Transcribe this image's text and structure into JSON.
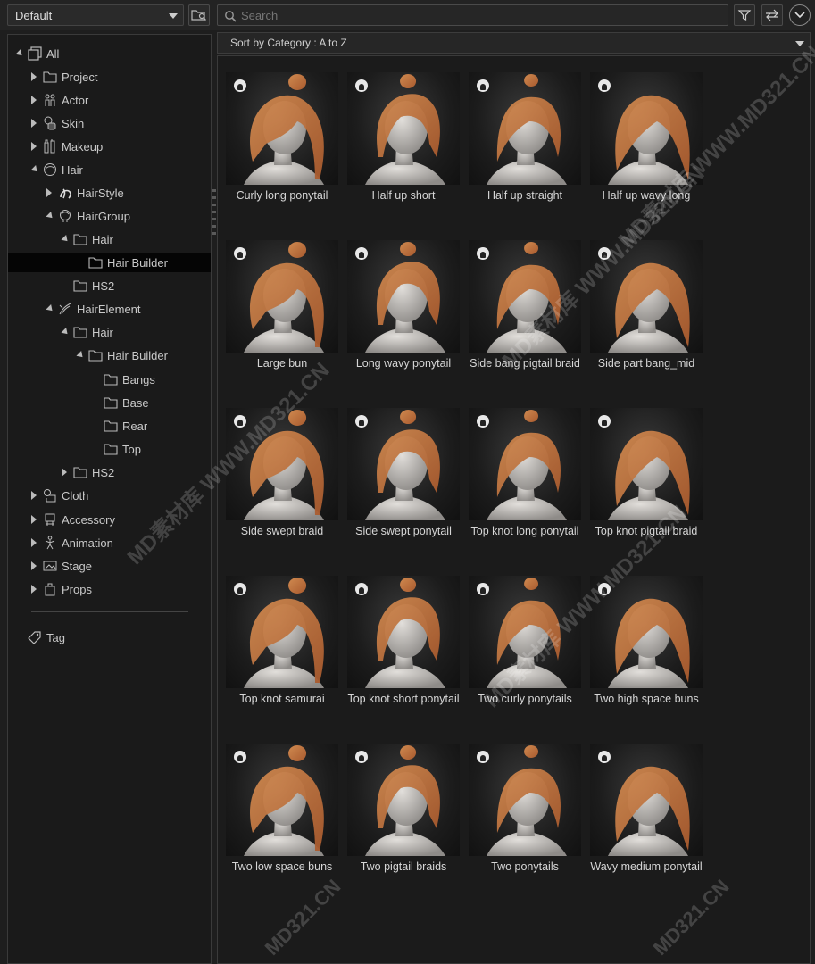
{
  "toolbar": {
    "preset_value": "Default",
    "search_placeholder": "Search"
  },
  "sortbar": {
    "label": "Sort by Category : A to Z"
  },
  "tree": [
    {
      "label": "All",
      "icon": "all-icon",
      "arrow": "down",
      "indent": 0,
      "selected": false
    },
    {
      "label": "Project",
      "icon": "folder-icon",
      "arrow": "right",
      "indent": 1,
      "selected": false
    },
    {
      "label": "Actor",
      "icon": "actor-icon",
      "arrow": "right",
      "indent": 1,
      "selected": false
    },
    {
      "label": "Skin",
      "icon": "skin-icon",
      "arrow": "right",
      "indent": 1,
      "selected": false
    },
    {
      "label": "Makeup",
      "icon": "makeup-icon",
      "arrow": "right",
      "indent": 1,
      "selected": false
    },
    {
      "label": "Hair",
      "icon": "hair-icon",
      "arrow": "down",
      "indent": 1,
      "selected": false
    },
    {
      "label": "HairStyle",
      "icon": "hairstyle-icon",
      "arrow": "right",
      "indent": 2,
      "selected": false
    },
    {
      "label": "HairGroup",
      "icon": "hairgroup-icon",
      "arrow": "down",
      "indent": 2,
      "selected": false
    },
    {
      "label": "Hair",
      "icon": "folder-icon",
      "arrow": "down",
      "indent": 3,
      "selected": false
    },
    {
      "label": "Hair Builder",
      "icon": "folder-icon",
      "arrow": "none",
      "indent": 4,
      "selected": true
    },
    {
      "label": "HS2",
      "icon": "folder-icon",
      "arrow": "none",
      "indent": 3,
      "selected": false
    },
    {
      "label": "HairElement",
      "icon": "hairelement-icon",
      "arrow": "down",
      "indent": 2,
      "selected": false
    },
    {
      "label": "Hair",
      "icon": "folder-icon",
      "arrow": "down",
      "indent": 3,
      "selected": false
    },
    {
      "label": "Hair Builder",
      "icon": "folder-icon",
      "arrow": "down",
      "indent": 4,
      "selected": false
    },
    {
      "label": "Bangs",
      "icon": "folder-icon",
      "arrow": "none",
      "indent": 5,
      "selected": false
    },
    {
      "label": "Base",
      "icon": "folder-icon",
      "arrow": "none",
      "indent": 5,
      "selected": false
    },
    {
      "label": "Rear",
      "icon": "folder-icon",
      "arrow": "none",
      "indent": 5,
      "selected": false
    },
    {
      "label": "Top",
      "icon": "folder-icon",
      "arrow": "none",
      "indent": 5,
      "selected": false
    },
    {
      "label": "HS2",
      "icon": "folder-icon",
      "arrow": "right",
      "indent": 3,
      "selected": false
    },
    {
      "label": "Cloth",
      "icon": "cloth-icon",
      "arrow": "right",
      "indent": 1,
      "selected": false
    },
    {
      "label": "Accessory",
      "icon": "accessory-icon",
      "arrow": "right",
      "indent": 1,
      "selected": false
    },
    {
      "label": "Animation",
      "icon": "animation-icon",
      "arrow": "right",
      "indent": 1,
      "selected": false
    },
    {
      "label": "Stage",
      "icon": "stage-icon",
      "arrow": "right",
      "indent": 1,
      "selected": false
    },
    {
      "label": "Props",
      "icon": "props-icon",
      "arrow": "right",
      "indent": 1,
      "selected": false
    }
  ],
  "tag": {
    "label": "Tag",
    "icon": "tag-icon"
  },
  "items": [
    {
      "label": "Curly long ponytail"
    },
    {
      "label": "Half up short"
    },
    {
      "label": "Half up straight"
    },
    {
      "label": "Half up wavy long"
    },
    {
      "label": "Large bun"
    },
    {
      "label": "Long wavy ponytail"
    },
    {
      "label": "Side bang pigtail braid"
    },
    {
      "label": "Side part bang_mid"
    },
    {
      "label": "Side swept braid"
    },
    {
      "label": "Side swept ponytail"
    },
    {
      "label": "Top knot long ponytail"
    },
    {
      "label": "Top knot pigtail braid"
    },
    {
      "label": "Top knot samurai"
    },
    {
      "label": "Top knot short ponytail"
    },
    {
      "label": "Two curly ponytails"
    },
    {
      "label": "Two high space buns"
    },
    {
      "label": "Two low space buns"
    },
    {
      "label": "Two pigtail braids"
    },
    {
      "label": "Two ponytails"
    },
    {
      "label": "Wavy medium ponytail"
    }
  ],
  "watermark": "MD素材库 WWW.MD321.CN",
  "watermark_short": "MD321.CN",
  "colors": {
    "hair": "#a85a2e",
    "hair_light": "#d08a50",
    "skin": "#c9c6c2",
    "selected_row": "#050505"
  }
}
